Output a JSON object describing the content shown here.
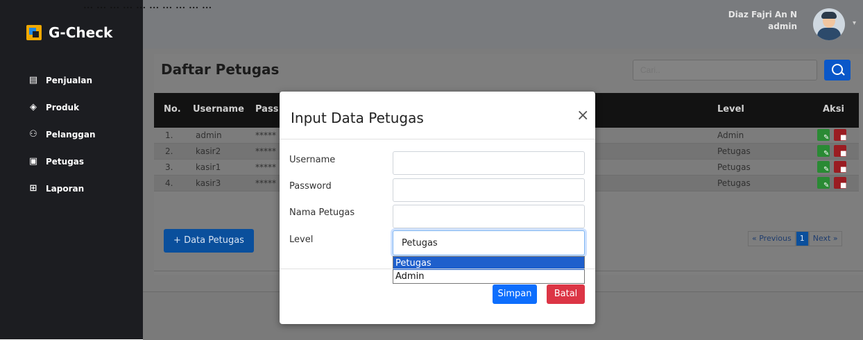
{
  "caption": "... ... ... ... ... ... ... ... ... ...",
  "brand": {
    "name": "G-Check"
  },
  "sidebar": {
    "items": [
      {
        "label": "Penjualan",
        "icon": "cash-register-icon"
      },
      {
        "label": "Produk",
        "icon": "box-icon"
      },
      {
        "label": "Pelanggan",
        "icon": "users-icon"
      },
      {
        "label": "Petugas",
        "icon": "id-card-icon"
      },
      {
        "label": "Laporan",
        "icon": "report-icon"
      }
    ]
  },
  "header": {
    "user_name": "Diaz Fajri An N",
    "user_role": "admin"
  },
  "page": {
    "title": "Daftar Petugas"
  },
  "search": {
    "placeholder": "Cari.."
  },
  "table": {
    "headers": {
      "no": "No.",
      "username": "Username",
      "password": "Pass",
      "level": "Level",
      "aksi": "Aksi"
    },
    "rows": [
      {
        "no": "1.",
        "username": "admin",
        "password": "*****",
        "level": "Admin"
      },
      {
        "no": "2.",
        "username": "kasir2",
        "password": "*****",
        "level": "Petugas"
      },
      {
        "no": "3.",
        "username": "kasir1",
        "password": "*****",
        "level": "Petugas"
      },
      {
        "no": "4.",
        "username": "kasir3",
        "password": "*****",
        "level": "Petugas"
      }
    ]
  },
  "actions": {
    "add_label": "+ Data Petugas"
  },
  "pagination": {
    "previous": "« Previous",
    "current": "1",
    "next": "Next »"
  },
  "modal": {
    "title": "Input Data Petugas",
    "close": "×",
    "fields": {
      "username": "Username",
      "password": "Password",
      "nama": "Nama Petugas",
      "level": "Level"
    },
    "level_selected": "Petugas",
    "level_options": [
      "Petugas",
      "Admin"
    ],
    "save_label": "Simpan",
    "cancel_label": "Batal"
  },
  "colors": {
    "sidebar": "#1c1d21",
    "primary": "#0d6efd",
    "danger": "#dc3545",
    "edit": "#28a745"
  }
}
